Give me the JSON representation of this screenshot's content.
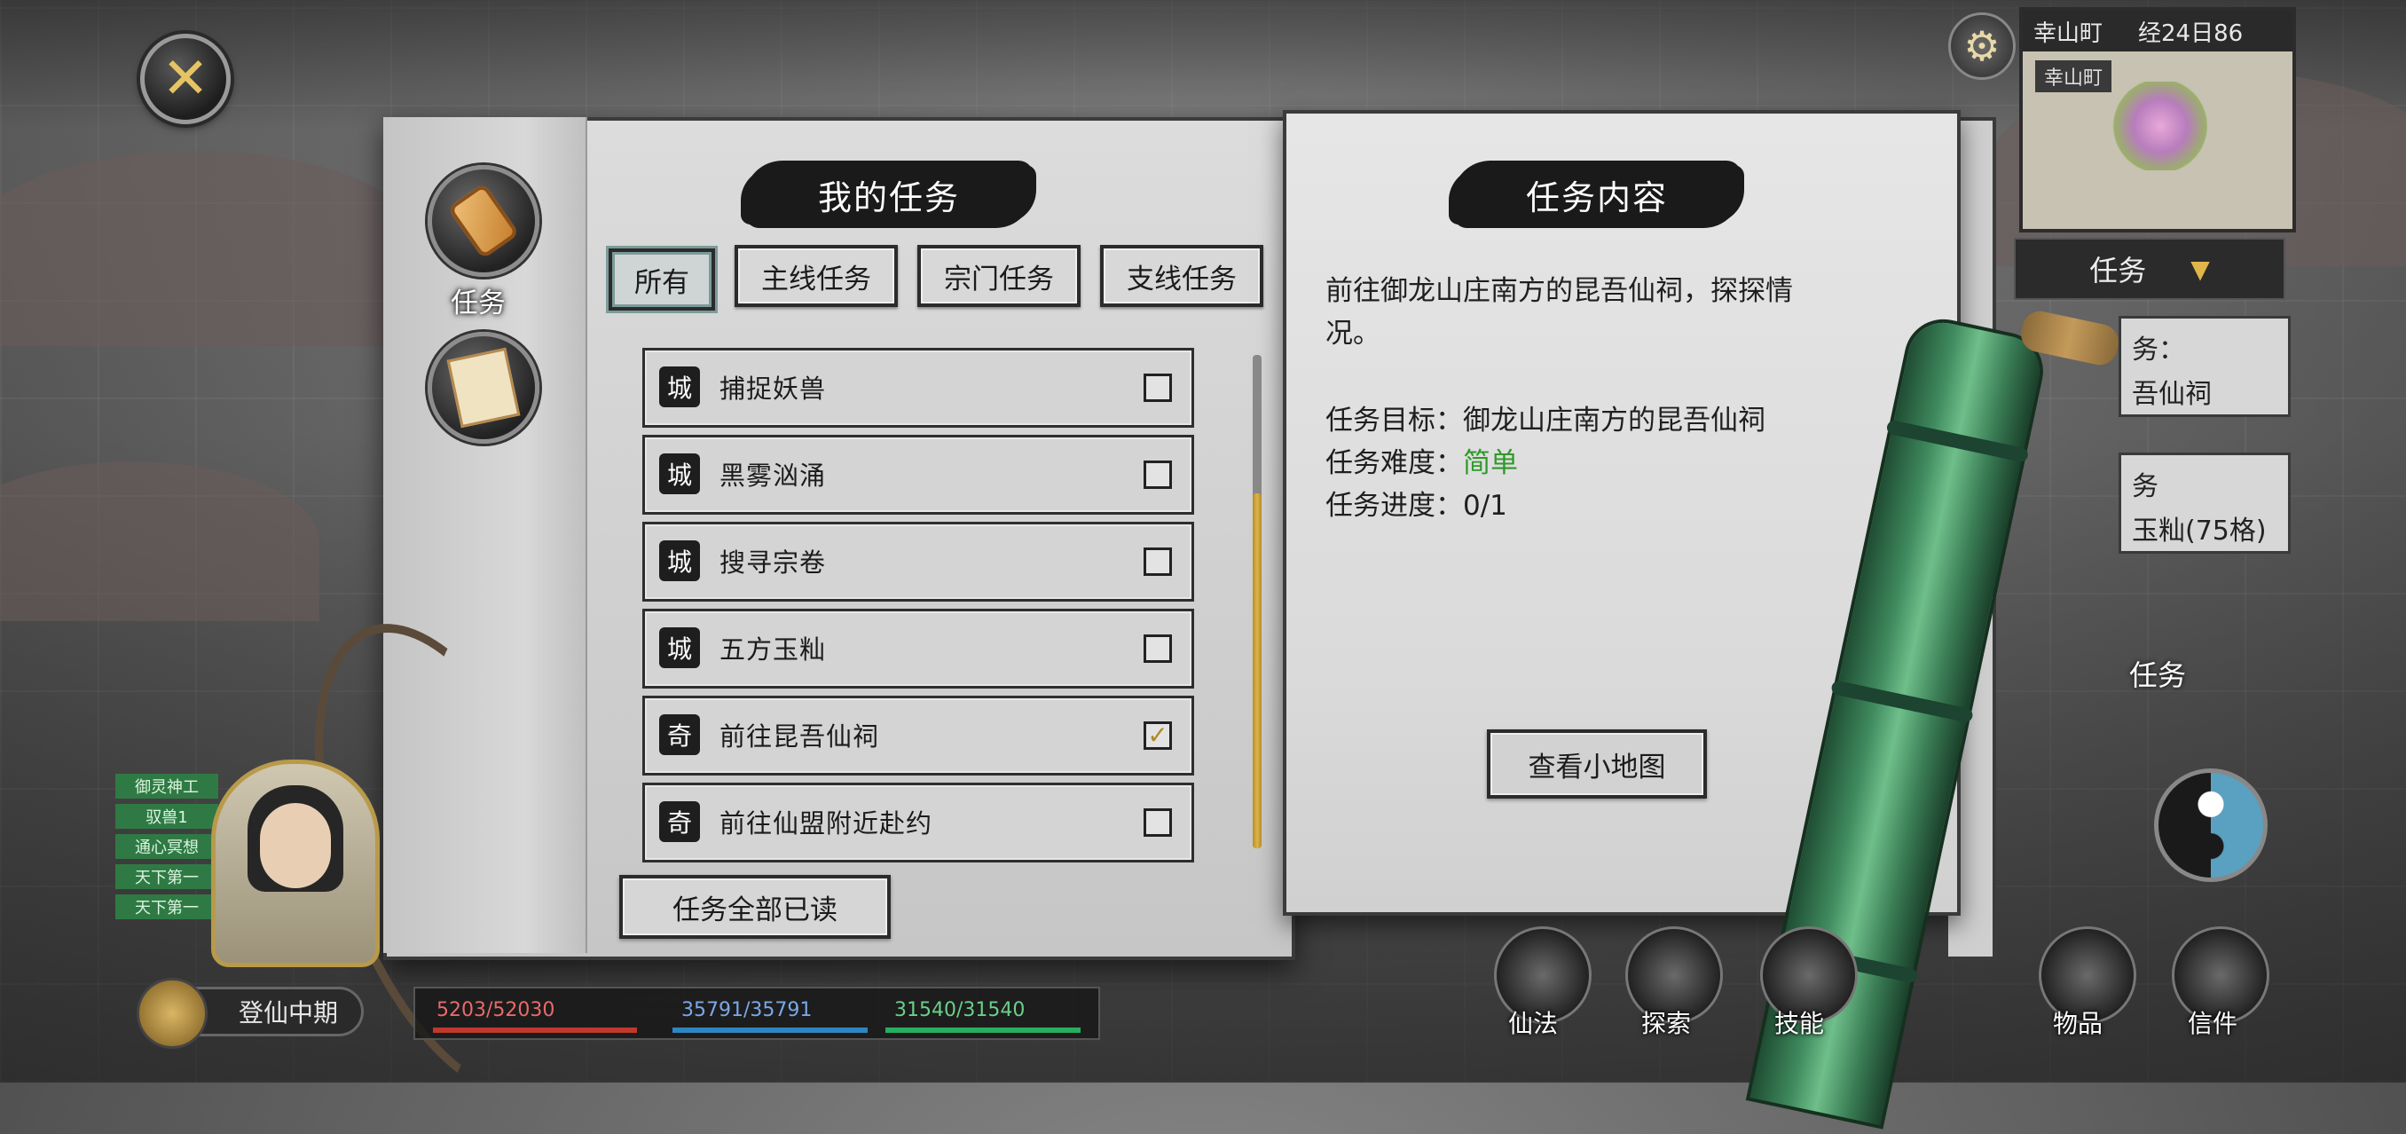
{
  "top_left": {
    "close_label": "✕"
  },
  "left_nav": {
    "items": [
      {
        "label": "任务",
        "icon": "scroll-icon"
      },
      {
        "label": "",
        "icon": "letter-icon"
      }
    ]
  },
  "quests_panel": {
    "title": "我的任务",
    "tabs": [
      {
        "label": "所有",
        "active": true
      },
      {
        "label": "主线任务",
        "active": false
      },
      {
        "label": "宗门任务",
        "active": false
      },
      {
        "label": "支线任务",
        "active": false
      }
    ],
    "list": [
      {
        "type": "城",
        "name": "捕捉妖兽",
        "checked": false
      },
      {
        "type": "城",
        "name": "黑雾汹涌",
        "checked": false
      },
      {
        "type": "城",
        "name": "搜寻宗卷",
        "checked": false
      },
      {
        "type": "城",
        "name": "五方玉籼",
        "checked": false
      },
      {
        "type": "奇",
        "name": "前往昆吾仙祠",
        "checked": true
      },
      {
        "type": "奇",
        "name": "前往仙盟附近赴约",
        "checked": false
      }
    ],
    "read_all_label": "任务全部已读"
  },
  "detail_panel": {
    "title": "任务内容",
    "description_line1": "前往御龙山庄南方的昆吾仙祠，探探情",
    "description_line2": "况。",
    "target_label": "任务目标：",
    "target_value": "御龙山庄南方的昆吾仙祠",
    "difficulty_label": "任务难度：",
    "difficulty_value": "简单",
    "progress_label": "任务进度：",
    "progress_value": "0/1",
    "map_button": "查看小地图",
    "colors": {
      "easy": "#2e9a2a"
    }
  },
  "hud_right": {
    "minimap_title": "幸山町",
    "minimap_time": "经24日86",
    "minimap_place": "幸山町",
    "task_dropdown": "任务",
    "card1_line1": "务：",
    "card1_line2": "吾仙祠",
    "card2_line1": "务",
    "card2_line2": "玉籼(75格)",
    "task_side_label": "任务"
  },
  "hud_bottom": {
    "buffs": [
      "御灵神工",
      "驭兽1",
      "通心冥想",
      "天下第一",
      "天下第一"
    ],
    "stage": "登仙中期",
    "stats": {
      "hp": "5203/52030",
      "mp": "35791/35791",
      "sp": "31540/31540"
    },
    "buttons": [
      {
        "label": "仙法",
        "icon": "spell-icon"
      },
      {
        "label": "探索",
        "icon": "explore-icon"
      },
      {
        "label": "技能",
        "icon": "skill-icon"
      },
      {
        "label": "物品",
        "icon": "bag-icon"
      },
      {
        "label": "信件",
        "icon": "mail-icon"
      }
    ]
  }
}
